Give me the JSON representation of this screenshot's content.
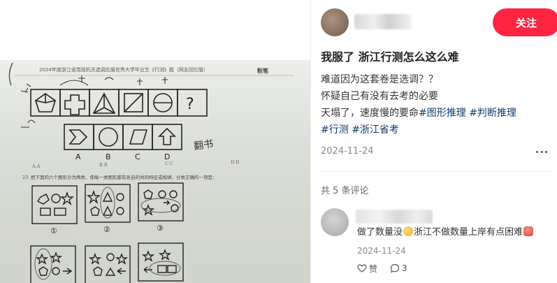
{
  "post": {
    "follow_label": "关注",
    "title": "我服了 浙江行测怎么这么难",
    "body_lines": [
      "难道因为这套卷是选调？？",
      "怀疑自己有没有去考的必要"
    ],
    "body_line3_text": "天塌了，速度慢的要命",
    "tags": [
      "#图形推理",
      "#判断推理",
      "#行测",
      "#浙江省考"
    ],
    "date": "2024-11-24"
  },
  "comments": {
    "count_label": "共 5 条评论",
    "items": [
      {
        "text_part1": "做了数量没",
        "text_part2": "浙江不做数量上岸有点困难",
        "date": "2024-11-24",
        "like_label": "赞",
        "reply_count": "3"
      }
    ]
  },
  "photo": {
    "header_text": "2024年度浙江省党政机关选调应届优秀大学毕业生《行测》题（网友回忆版）",
    "brand_text": "粉笔",
    "options": [
      "A",
      "B",
      "C",
      "D"
    ],
    "question_mark": "?",
    "question_no": "23",
    "question_text": "把下面的六个图形分为两类，使每一类图形都有各自的共同特征或规律，分类正确的一项是：",
    "answer_options": [
      "A.A",
      "B.B",
      "C.C",
      "D.D"
    ],
    "group_labels": [
      "①",
      "②",
      "③"
    ],
    "handwritten_note": "翻书"
  },
  "colors": {
    "brand_red": "#ff2442",
    "hashtag_blue": "#13386c",
    "muted_gray": "#8a8a8a"
  },
  "icons": [
    "more-icon",
    "like-icon",
    "comment-icon"
  ]
}
